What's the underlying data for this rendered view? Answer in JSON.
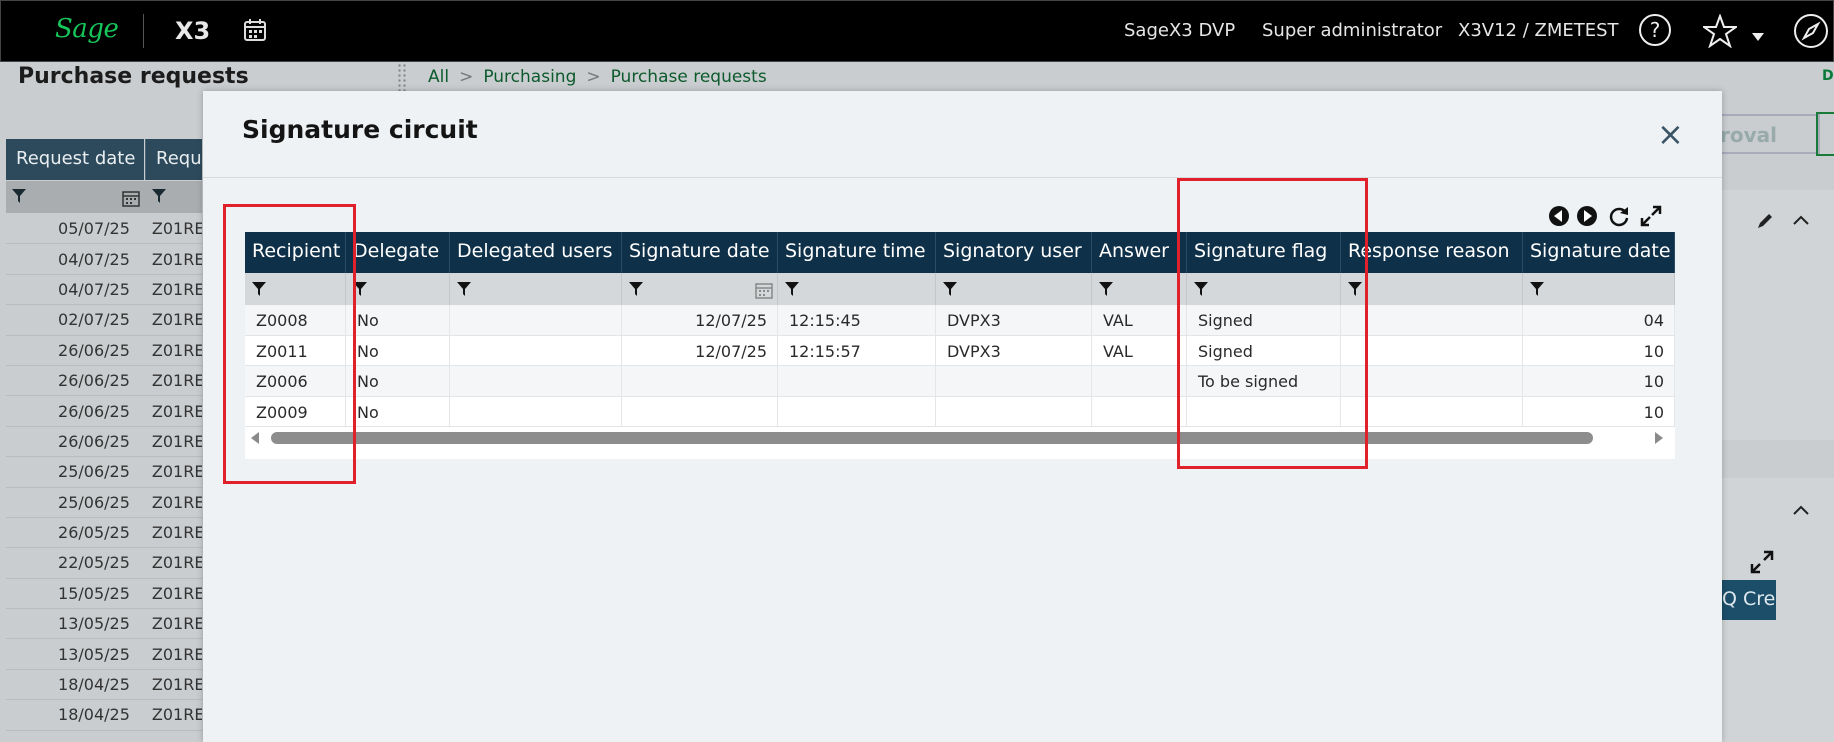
{
  "topbar": {
    "logo": "Sage",
    "product": "X3",
    "endpoint": "SageX3 DVP",
    "user": "Super administrator",
    "folder": "X3V12 / ZMETEST"
  },
  "page": {
    "title": "Purchase requests",
    "breadcrumb": [
      "All",
      "Purchasing",
      "Purchase requests"
    ],
    "right_peek": "D",
    "approval_button": "roval",
    "quick_button": "Q Crea"
  },
  "bg_table": {
    "headers": [
      "Request date",
      "Reque"
    ],
    "rows": [
      {
        "date": "05/07/25",
        "req": "Z01RE"
      },
      {
        "date": "04/07/25",
        "req": "Z01RE"
      },
      {
        "date": "04/07/25",
        "req": "Z01RE"
      },
      {
        "date": "02/07/25",
        "req": "Z01RE"
      },
      {
        "date": "26/06/25",
        "req": "Z01RE"
      },
      {
        "date": "26/06/25",
        "req": "Z01RE"
      },
      {
        "date": "26/06/25",
        "req": "Z01RE"
      },
      {
        "date": "26/06/25",
        "req": "Z01RE"
      },
      {
        "date": "25/06/25",
        "req": "Z01RE"
      },
      {
        "date": "25/06/25",
        "req": "Z01RE"
      },
      {
        "date": "26/05/25",
        "req": "Z01RE"
      },
      {
        "date": "22/05/25",
        "req": "Z01RE"
      },
      {
        "date": "15/05/25",
        "req": "Z01RE"
      },
      {
        "date": "13/05/25",
        "req": "Z01RE"
      },
      {
        "date": "13/05/25",
        "req": "Z01RE"
      },
      {
        "date": "18/04/25",
        "req": "Z01RE"
      },
      {
        "date": "18/04/25",
        "req": "Z01RE"
      }
    ]
  },
  "modal": {
    "title": "Signature circuit",
    "close_label": "×",
    "columns": [
      "Recipient",
      "Delegate",
      "Delegated users",
      "Signature date",
      "Signature time",
      "Signatory user",
      "Answer",
      "Signature flag",
      "Response reason",
      "Signature date"
    ],
    "rows": [
      [
        "Z0008",
        "No",
        "",
        "12/07/25",
        "12:15:45",
        "DVPX3",
        "VAL",
        "Signed",
        "",
        "04"
      ],
      [
        "Z0011",
        "No",
        "",
        "12/07/25",
        "12:15:57",
        "DVPX3",
        "VAL",
        "Signed",
        "",
        "10"
      ],
      [
        "Z0006",
        "No",
        "",
        "",
        "",
        "",
        "",
        "To be signed",
        "",
        "10"
      ],
      [
        "Z0009",
        "No",
        "",
        "",
        "",
        "",
        "",
        "",
        "",
        "10"
      ]
    ]
  },
  "colors": {
    "topbar": "#000000",
    "brand_green": "#16c55a",
    "grid_header": "#0e3048",
    "highlight": "#e0202a"
  }
}
